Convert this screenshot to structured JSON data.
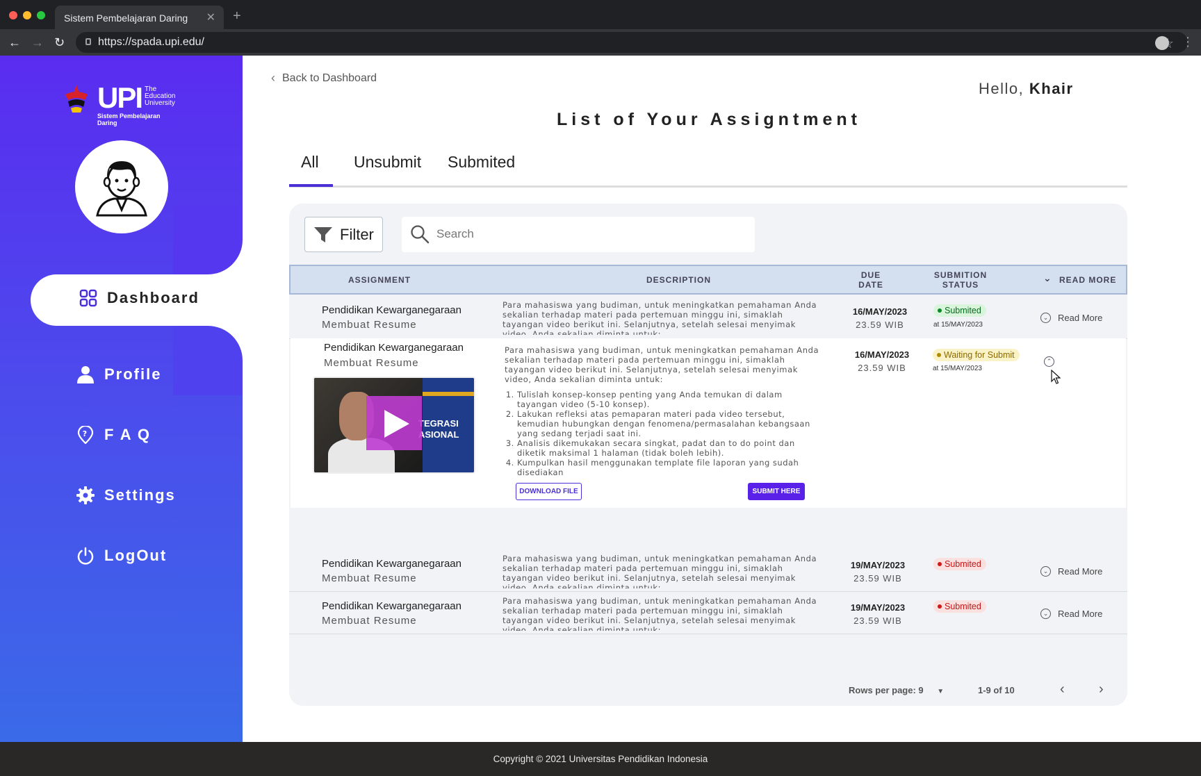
{
  "browser": {
    "tab_title": "Sistem Pembelajaran Daring",
    "url": "https://spada.upi.edu/"
  },
  "sidebar": {
    "logo_text": "UPI",
    "logo_tagline_1": "The",
    "logo_tagline_2": "Education",
    "logo_tagline_3": "University",
    "logo_subtitle": "Sistem Pembelajaran Daring",
    "items": [
      {
        "label": "Dashboard",
        "icon": "grid-icon",
        "active": true
      },
      {
        "label": "Profile",
        "icon": "user-icon"
      },
      {
        "label": "F A Q",
        "icon": "location-pin-icon"
      },
      {
        "label": "Settings",
        "icon": "gear-icon"
      },
      {
        "label": "LogOut",
        "icon": "power-icon"
      }
    ]
  },
  "header": {
    "back_label": "Back to Dashboard",
    "hello_prefix": "Hello,",
    "user_name": "Khair",
    "title": "List of Your Assigntment"
  },
  "tabs": [
    {
      "label": "All",
      "active": true
    },
    {
      "label": "Unsubmit"
    },
    {
      "label": "Submited"
    }
  ],
  "controls": {
    "filter_label": "Filter",
    "search_placeholder": "Search"
  },
  "table": {
    "headers": {
      "assignment": "ASSIGNMENT",
      "description": "DESCRIPTION",
      "due_1": "DUE",
      "due_2": "DATE",
      "status_1": "SUBMITION",
      "status_2": "STATUS",
      "read_more": "READ MORE"
    },
    "rows": [
      {
        "title": "Pendidikan Kewarganegaraan",
        "subtitle": "Membuat Resume",
        "description": "Para mahasiswa yang budiman, untuk meningkatkan pemahaman Anda sekalian terhadap materi pada pertemuan minggu ini, simaklah tayangan video berikut ini. Selanjutnya, setelah selesai menyimak video, Anda sekalian diminta untuk:",
        "due_date": "16/MAY/2023",
        "due_time": "23.59 WIB",
        "status": "Submited",
        "status_color": "#0a8a2a",
        "submitted_at": "at 15/MAY/2023",
        "read_more": "Read More"
      },
      {
        "title": "Pendidikan Kewarganegaraan",
        "subtitle": "Membuat Resume",
        "description": "Para mahasiswa yang budiman, untuk meningkatkan pemahaman Anda sekalian terhadap materi pada pertemuan minggu ini, simaklah tayangan video berikut ini. Selanjutnya, setelah selesai menyimak video, Anda sekalian diminta untuk:",
        "due_date": "16/MAY/2023",
        "due_time": "23.59 WIB",
        "status": "Waiting for Submit",
        "status_color": "#b08a00",
        "submitted_at": "at 15/MAY/2023",
        "video_text_1": "TEGRASI",
        "video_text_2": "ASIONAL",
        "tasks": [
          "Tulislah konsep-konsep penting yang Anda temukan di dalam tayangan video (5-10 konsep).",
          "Lakukan refleksi atas pemaparan materi pada video tersebut, kemudian hubungkan dengan fenomena/permasalahan kebangsaan yang sedang terjadi saat ini.",
          "Analisis dikemukakan secara singkat, padat dan to do point dan diketik maksimal 1 halaman (tidak boleh lebih).",
          "Kumpulkan hasil menggunakan template file laporan yang sudah disediakan"
        ],
        "download_label": "DOWNLOAD FILE",
        "submit_label": "SUBMIT HERE"
      },
      {
        "title": "Pendidikan Kewarganegaraan",
        "subtitle": "Membuat Resume",
        "description": "Para mahasiswa yang budiman, untuk meningkatkan pemahaman Anda sekalian terhadap materi pada pertemuan minggu ini, simaklah tayangan video berikut ini. Selanjutnya, setelah selesai menyimak video, Anda sekalian diminta untuk:",
        "due_date": "19/MAY/2023",
        "due_time": "23.59 WIB",
        "status": "Submited",
        "status_color": "#d01818",
        "read_more": "Read More"
      },
      {
        "title": "Pendidikan Kewarganegaraan",
        "subtitle": "Membuat Resume",
        "description": "Para mahasiswa yang budiman, untuk meningkatkan pemahaman Anda sekalian terhadap materi pada pertemuan minggu ini, simaklah tayangan video berikut ini. Selanjutnya, setelah selesai menyimak video, Anda sekalian diminta untuk:",
        "due_date": "19/MAY/2023",
        "due_time": "23.59 WIB",
        "status": "Submited",
        "status_color": "#d01818",
        "read_more": "Read More"
      }
    ]
  },
  "pagination": {
    "rows_per_page": "Rows per page: 9",
    "range": "1-9 of 10"
  },
  "footer": {
    "copyright": "Copyright © 2021 Universitas Pendidikan Indonesia"
  }
}
